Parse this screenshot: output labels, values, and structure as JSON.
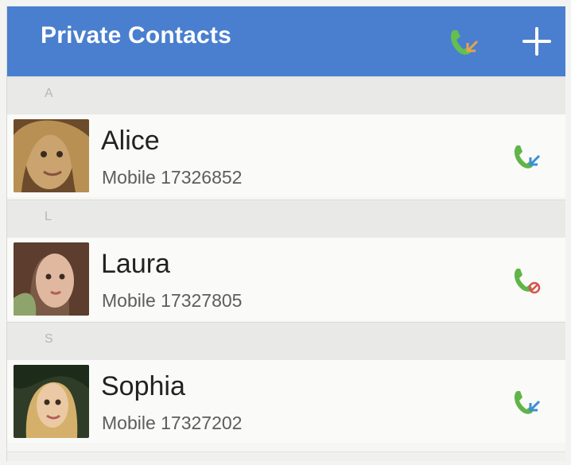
{
  "header": {
    "title": "Private Contacts",
    "call_log_icon": "incoming-call-icon",
    "add_icon": "plus-icon",
    "color": "#4a7fcf"
  },
  "sections": [
    {
      "letter": "A",
      "contacts": [
        {
          "name": "Alice",
          "phone": "Mobile 17326852",
          "call_status": "incoming",
          "status_icon": "incoming-call-icon"
        }
      ]
    },
    {
      "letter": "L",
      "contacts": [
        {
          "name": "Laura",
          "phone": "Mobile 17327805",
          "call_status": "blocked",
          "status_icon": "blocked-call-icon"
        }
      ]
    },
    {
      "letter": "S",
      "contacts": [
        {
          "name": "Sophia",
          "phone": "Mobile 17327202",
          "call_status": "incoming",
          "status_icon": "incoming-call-icon"
        }
      ]
    }
  ],
  "colors": {
    "call_green": "#5fb548",
    "arrow_blue": "#3a8fd3",
    "blocked_red": "#d9534f"
  }
}
